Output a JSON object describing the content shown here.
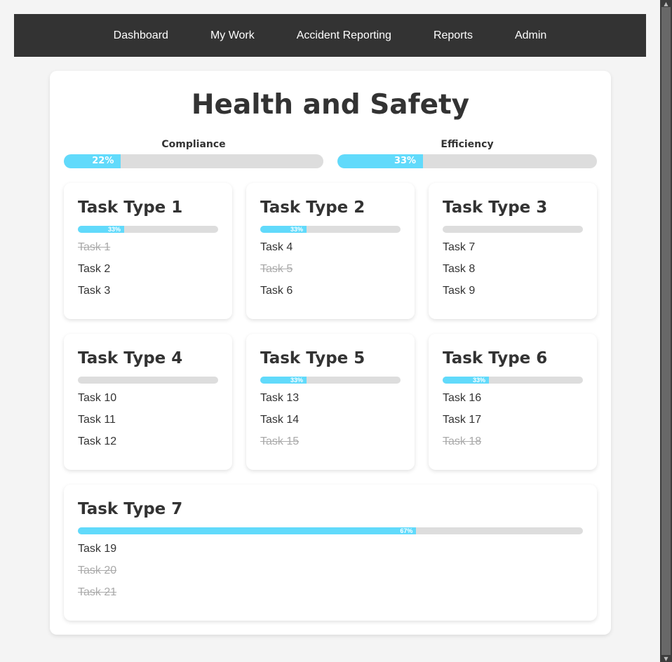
{
  "nav": {
    "items": [
      {
        "label": "Dashboard"
      },
      {
        "label": "My Work"
      },
      {
        "label": "Accident Reporting"
      },
      {
        "label": "Reports"
      },
      {
        "label": "Admin"
      }
    ]
  },
  "page": {
    "title": "Health and Safety"
  },
  "metrics": {
    "compliance": {
      "label": "Compliance",
      "value": 22,
      "text": "22%"
    },
    "efficiency": {
      "label": "Efficiency",
      "value": 33,
      "text": "33%"
    }
  },
  "colors": {
    "accent": "#61dafb",
    "track": "#dddddd",
    "navbar": "#333333",
    "done_text": "#aaaaaa"
  },
  "task_types": [
    {
      "title": "Task Type 1",
      "progress": 33,
      "progress_text": "33%",
      "tasks": [
        {
          "label": "Task 1",
          "done": true
        },
        {
          "label": "Task 2",
          "done": false
        },
        {
          "label": "Task 3",
          "done": false
        }
      ]
    },
    {
      "title": "Task Type 2",
      "progress": 33,
      "progress_text": "33%",
      "tasks": [
        {
          "label": "Task 4",
          "done": false
        },
        {
          "label": "Task 5",
          "done": true
        },
        {
          "label": "Task 6",
          "done": false
        }
      ]
    },
    {
      "title": "Task Type 3",
      "progress": 0,
      "progress_text": "",
      "tasks": [
        {
          "label": "Task 7",
          "done": false
        },
        {
          "label": "Task 8",
          "done": false
        },
        {
          "label": "Task 9",
          "done": false
        }
      ]
    },
    {
      "title": "Task Type 4",
      "progress": 0,
      "progress_text": "",
      "tasks": [
        {
          "label": "Task 10",
          "done": false
        },
        {
          "label": "Task 11",
          "done": false
        },
        {
          "label": "Task 12",
          "done": false
        }
      ]
    },
    {
      "title": "Task Type 5",
      "progress": 33,
      "progress_text": "33%",
      "tasks": [
        {
          "label": "Task 13",
          "done": false
        },
        {
          "label": "Task 14",
          "done": false
        },
        {
          "label": "Task 15",
          "done": true
        }
      ]
    },
    {
      "title": "Task Type 6",
      "progress": 33,
      "progress_text": "33%",
      "tasks": [
        {
          "label": "Task 16",
          "done": false
        },
        {
          "label": "Task 17",
          "done": false
        },
        {
          "label": "Task 18",
          "done": true
        }
      ]
    },
    {
      "title": "Task Type 7",
      "progress": 67,
      "progress_text": "67%",
      "tasks": [
        {
          "label": "Task 19",
          "done": false
        },
        {
          "label": "Task 20",
          "done": true
        },
        {
          "label": "Task 21",
          "done": true
        }
      ]
    }
  ]
}
